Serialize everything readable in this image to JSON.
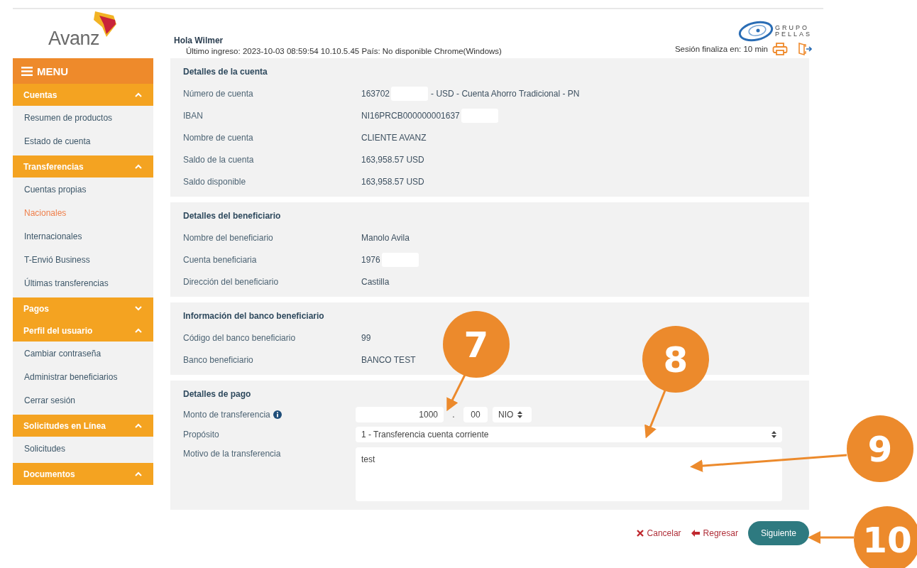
{
  "brand": {
    "name": "Avanz"
  },
  "partner_logo": {
    "line_1": "GRUPO",
    "line_2": "PELLAS"
  },
  "header": {
    "greeting": "Hola Wilmer",
    "last_login": "Último ingreso: 2023-10-03 08:59:54 10.10.5.45 País: No disponible Chrome(Windows)",
    "session": "Sesión finaliza en: 10 min"
  },
  "menu": {
    "title": "MENU",
    "groups": [
      {
        "label": "Cuentas",
        "expanded": true,
        "items": [
          {
            "label": "Resumen de productos",
            "selected": false
          },
          {
            "label": "Estado de cuenta",
            "selected": false
          }
        ]
      },
      {
        "label": "Transferencias",
        "expanded": true,
        "items": [
          {
            "label": "Cuentas propias",
            "selected": false
          },
          {
            "label": "Nacionales",
            "selected": true
          },
          {
            "label": "Internacionales",
            "selected": false
          },
          {
            "label": "T-Envió Business",
            "selected": false
          },
          {
            "label": "Últimas transferencias",
            "selected": false
          }
        ]
      },
      {
        "label": "Pagos",
        "expanded": false
      },
      {
        "label": "Perfil del usuario",
        "expanded": true,
        "items": [
          {
            "label": "Cambiar contraseña",
            "selected": false
          },
          {
            "label": "Administrar beneficiarios",
            "selected": false
          },
          {
            "label": "Cerrar sesión",
            "selected": false
          }
        ]
      },
      {
        "label": "Solicitudes en Línea",
        "expanded": true,
        "items": [
          {
            "label": "Solicitudes",
            "selected": false
          }
        ]
      },
      {
        "label": "Documentos",
        "expanded": true
      }
    ]
  },
  "sections": [
    {
      "title": "Detalles de la cuenta",
      "rows": [
        {
          "label": "Número de cuenta",
          "value": "163702",
          "redacted": true,
          "value_suffix": "- USD - Cuenta Ahorro Tradicional - PN"
        },
        {
          "label": "IBAN",
          "value": "NI16PRCB000000001637",
          "redacted": true
        },
        {
          "label": "Nombre de cuenta",
          "value": "CLIENTE AVANZ"
        },
        {
          "label": "Saldo de la cuenta",
          "value": "163,958.57 USD"
        },
        {
          "label": "Saldo disponible",
          "value": "163,958.57 USD"
        }
      ]
    },
    {
      "title": "Detalles del beneficiario",
      "rows": [
        {
          "label": "Nombre del beneficiario",
          "value": "Manolo Avila"
        },
        {
          "label": "Cuenta beneficiaria",
          "value": "1976",
          "redacted": true
        },
        {
          "label": "Dirección del beneficiario",
          "value": "Castilla"
        }
      ]
    },
    {
      "title": "Información del banco beneficiario",
      "rows": [
        {
          "label": "Código del banco beneficiario",
          "value": "99"
        },
        {
          "label": "Banco beneficiario",
          "value": "BANCO TEST"
        }
      ]
    }
  ],
  "payment": {
    "title": "Detalles de pago",
    "amount": {
      "label": "Monto de transferencia",
      "whole": "1000",
      "separator": ".",
      "cents": "00",
      "currency": "NIO"
    },
    "purpose": {
      "label": "Propósito",
      "value": "1 - Transferencia cuenta corriente"
    },
    "reason": {
      "label": "Motivo de la transferencia",
      "value": "test"
    }
  },
  "actions": [
    {
      "kind": "cancel",
      "label": "Cancelar"
    },
    {
      "kind": "back",
      "label": "Regresar"
    },
    {
      "kind": "next",
      "label": "Siguiente"
    }
  ],
  "callouts": [
    {
      "number": "7"
    },
    {
      "number": "8"
    },
    {
      "number": "9"
    },
    {
      "number": "10"
    }
  ]
}
